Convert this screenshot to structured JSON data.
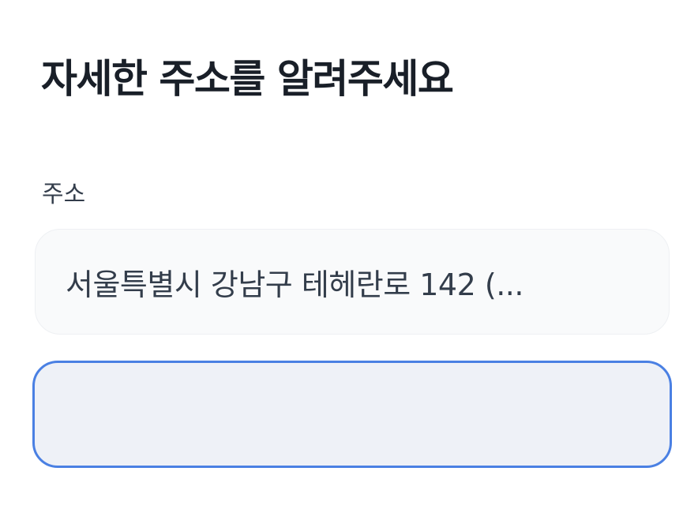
{
  "title": "자세한 주소를 알려주세요",
  "address_field": {
    "label": "주소",
    "value": "서울특별시 강남구 테헤란로 142 (..."
  },
  "detail_field": {
    "value": "",
    "placeholder": ""
  },
  "colors": {
    "accent": "#4a80e3",
    "title_text": "#191f28",
    "body_text": "#333d4b",
    "box_background": "#f9fafb",
    "input_background": "#eef1f7"
  }
}
